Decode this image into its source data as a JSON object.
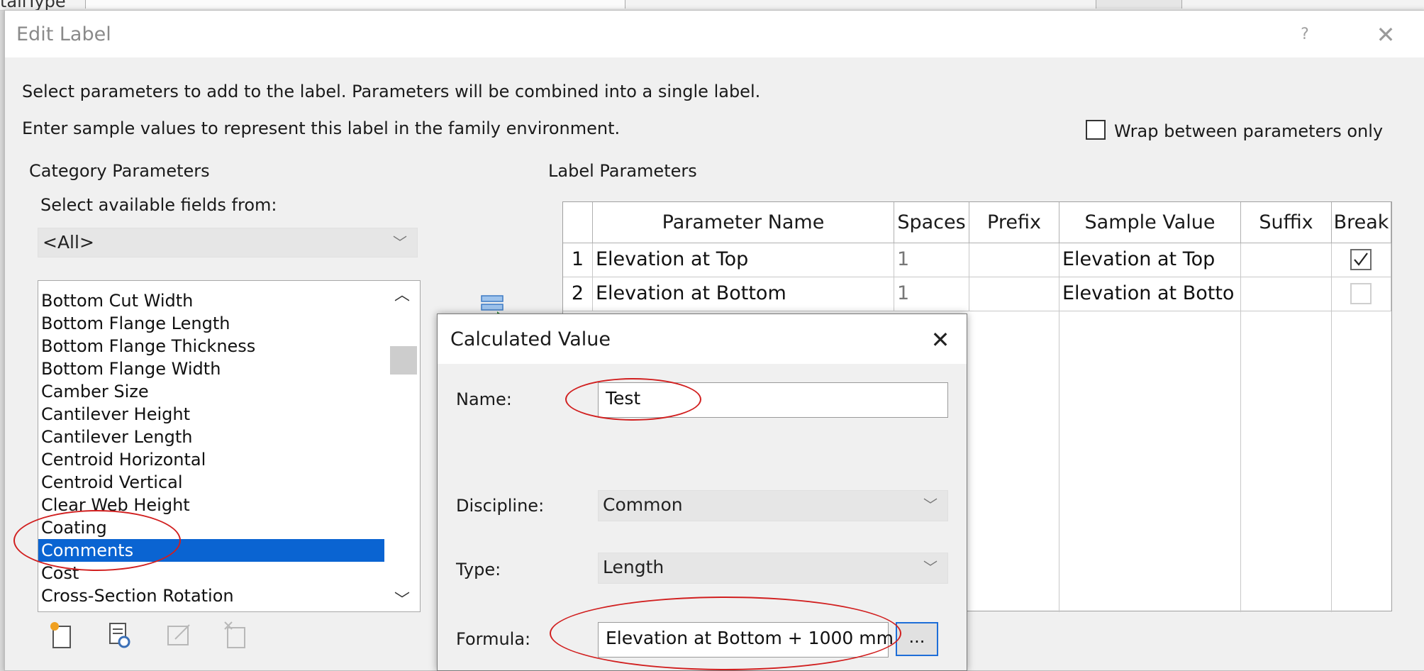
{
  "background": {
    "fragment": "tailType"
  },
  "dialog": {
    "title": "Edit Label",
    "help": "?",
    "close": "✕",
    "instr1": "Select parameters to add to the label.  Parameters will be combined into a single label.",
    "instr2": "Enter sample values to represent this label in the family environment.",
    "wrap_label": "Wrap between parameters only",
    "category_heading": "Category Parameters",
    "fields_from_label": "Select available fields from:",
    "fields_from_value": "<All>",
    "label_params_heading": "Label Parameters"
  },
  "param_list": [
    "Bottom Cut Width",
    "Bottom Flange Length",
    "Bottom Flange Thickness",
    "Bottom Flange Width",
    "Camber Size",
    "Cantilever Height",
    "Cantilever Length",
    "Centroid Horizontal",
    "Centroid Vertical",
    "Clear Web Height",
    "Coating",
    "Comments",
    "Cost",
    "Cross-Section Rotation"
  ],
  "selected_item": "Comments",
  "grid": {
    "headers": [
      "Parameter Name",
      "Spaces",
      "Prefix",
      "Sample Value",
      "Suffix",
      "Break"
    ],
    "rows": [
      {
        "num": "1",
        "name": "Elevation at Top",
        "spaces": "1",
        "prefix": "",
        "sample": "Elevation at Top",
        "suffix": "",
        "break": true
      },
      {
        "num": "2",
        "name": "Elevation at Bottom",
        "spaces": "1",
        "prefix": "",
        "sample": "Elevation at Botto",
        "suffix": "",
        "break": false
      }
    ]
  },
  "calc": {
    "title": "Calculated Value",
    "close": "✕",
    "name_label": "Name:",
    "name_value": "Test",
    "discipline_label": "Discipline:",
    "discipline_value": "Common",
    "type_label": "Type:",
    "type_value": "Length",
    "formula_label": "Formula:",
    "formula_value": "Elevation at Bottom + 1000 mm",
    "dots": "..."
  },
  "colors": {
    "selection": "#0a64d2",
    "annotation": "#d11f1f"
  }
}
